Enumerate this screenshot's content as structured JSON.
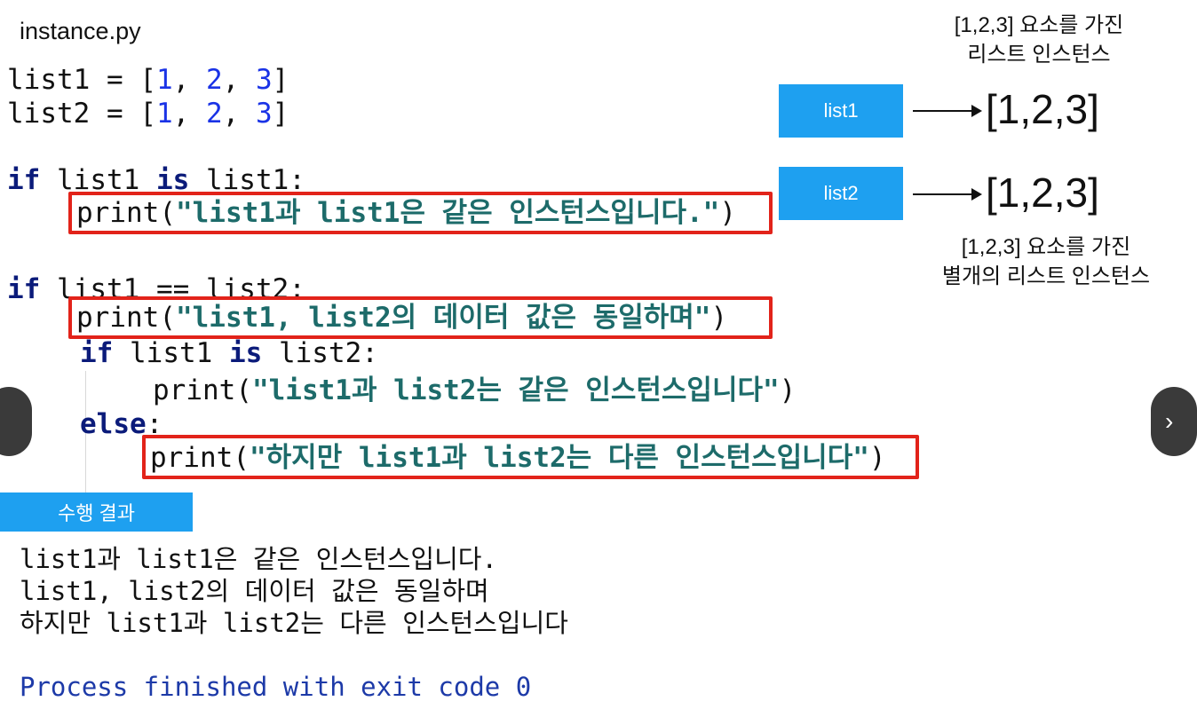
{
  "file_label": "instance.py",
  "code": {
    "line1": {
      "name": "list1",
      "eq": " = [",
      "n1": "1",
      "c1": ", ",
      "n2": "2",
      "c2": ", ",
      "n3": "3",
      "close": "]"
    },
    "line2": {
      "name": "list2",
      "eq": " = [",
      "n1": "1",
      "c1": ", ",
      "n2": "2",
      "c2": ", ",
      "n3": "3",
      "close": "]"
    },
    "if1": {
      "kw": "if",
      "a": " list1 ",
      "is": "is",
      "b": " list1:"
    },
    "print1": {
      "fn": "print(",
      "str": "\"list1과 list1은 같은 인스턴스입니다.\"",
      "close": ")"
    },
    "if2": {
      "kw": "if",
      "a": " list1 == list2:"
    },
    "print2": {
      "fn": "print(",
      "str": "\"list1, list2의 데이터 값은 동일하며\"",
      "close": ")"
    },
    "if3": {
      "kw": "if",
      "a": " list1 ",
      "is": "is",
      "b": " list2:"
    },
    "print3": {
      "fn": "print(",
      "str": "\"list1과 list2는 같은 인스턴스입니다\"",
      "close": ")"
    },
    "else": {
      "kw": "else",
      "colon": ":"
    },
    "print4": {
      "fn": "print(",
      "str": "\"하지만 list1과 list2는 다른 인스턴스입니다\"",
      "close": ")"
    }
  },
  "diagram": {
    "note_top_line1": "[1,2,3] 요소를 가진",
    "note_top_line2": "리스트 인스턴스",
    "var1": "list1",
    "value1": "[1,2,3]",
    "var2": "list2",
    "value2": "[1,2,3]",
    "note_bottom_line1": "[1,2,3] 요소를 가진",
    "note_bottom_line2": "별개의 리스트 인스턴스"
  },
  "result_label": "수행 결과",
  "output": {
    "line1": "list1과 list1은 같은 인스턴스입니다.",
    "line2": "list1, list2의 데이터 값은 동일하며",
    "line3": "하지만 list1과 list2는 다른 인스턴스입니다",
    "line4": "Process finished with exit code 0"
  },
  "nav": {
    "prev_icon": "chevron-left-icon",
    "next_icon": "chevron-right-icon",
    "next_glyph": "›"
  },
  "colors": {
    "highlight": "#e2231a",
    "var_box": "#1ea0f0",
    "keyword": "#0b1b7a",
    "number": "#1a33e6",
    "string": "#1d6b6a"
  }
}
